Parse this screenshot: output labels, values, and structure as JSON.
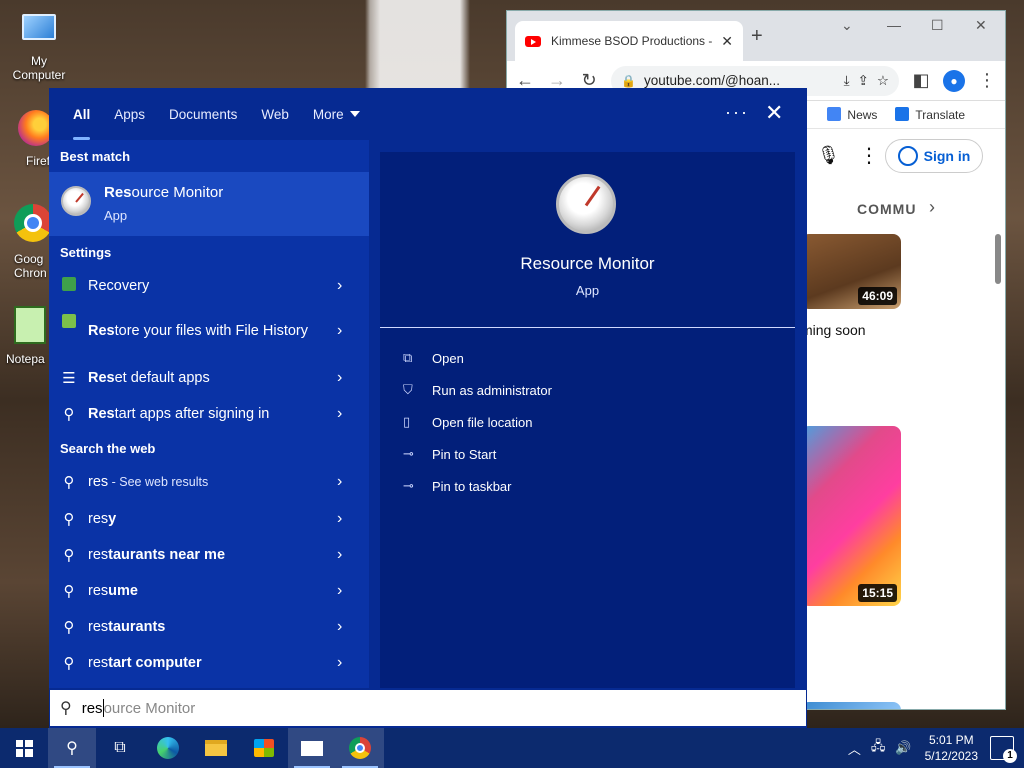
{
  "desktop": {
    "icons": [
      {
        "label": "My Computer"
      },
      {
        "label": "Firefo"
      },
      {
        "label": "Goog\nChron"
      },
      {
        "label": "Notepa"
      }
    ]
  },
  "chrome": {
    "tab_title": "Kimmese BSOD Productions -",
    "url": "youtube.com/@hoan...",
    "bookmarks": [
      "News",
      "Translate"
    ],
    "signin_label": "Sign in",
    "community_label": "COMMU",
    "video1_duration": "46:09",
    "coming_soon": "ming soon",
    "video2_duration": "15:15"
  },
  "search": {
    "tabs": [
      "All",
      "Apps",
      "Documents",
      "Web",
      "More"
    ],
    "more_dots": "···",
    "best_match_heading": "Best match",
    "best_match": {
      "name_bold": "Res",
      "name_rest": "ource Monitor",
      "type": "App"
    },
    "settings_heading": "Settings",
    "settings_items": [
      {
        "bold": "",
        "text": "Recovery"
      },
      {
        "bold": "Res",
        "text": "tore your files with File History"
      },
      {
        "bold": "Res",
        "text": "et default apps"
      },
      {
        "bold": "Res",
        "text": "tart apps after signing in"
      }
    ],
    "web_heading": "Search the web",
    "web_items": [
      {
        "prefix": "res",
        "rest": "",
        "hint": " - See web results"
      },
      {
        "prefix": "res",
        "rest": "y",
        "hint": ""
      },
      {
        "prefix": "res",
        "rest": "taurants near me",
        "hint": ""
      },
      {
        "prefix": "res",
        "rest": "ume",
        "hint": ""
      },
      {
        "prefix": "res",
        "rest": "taurants",
        "hint": ""
      },
      {
        "prefix": "res",
        "rest": "tart computer",
        "hint": ""
      }
    ],
    "detail": {
      "title": "Resource Monitor",
      "subtitle": "App",
      "actions": [
        "Open",
        "Run as administrator",
        "Open file location",
        "Pin to Start",
        "Pin to taskbar"
      ]
    },
    "input": {
      "typed": "res",
      "suggestion": "ource Monitor"
    }
  },
  "taskbar": {
    "time": "5:01 PM",
    "date": "5/12/2023",
    "notification_count": "1"
  }
}
